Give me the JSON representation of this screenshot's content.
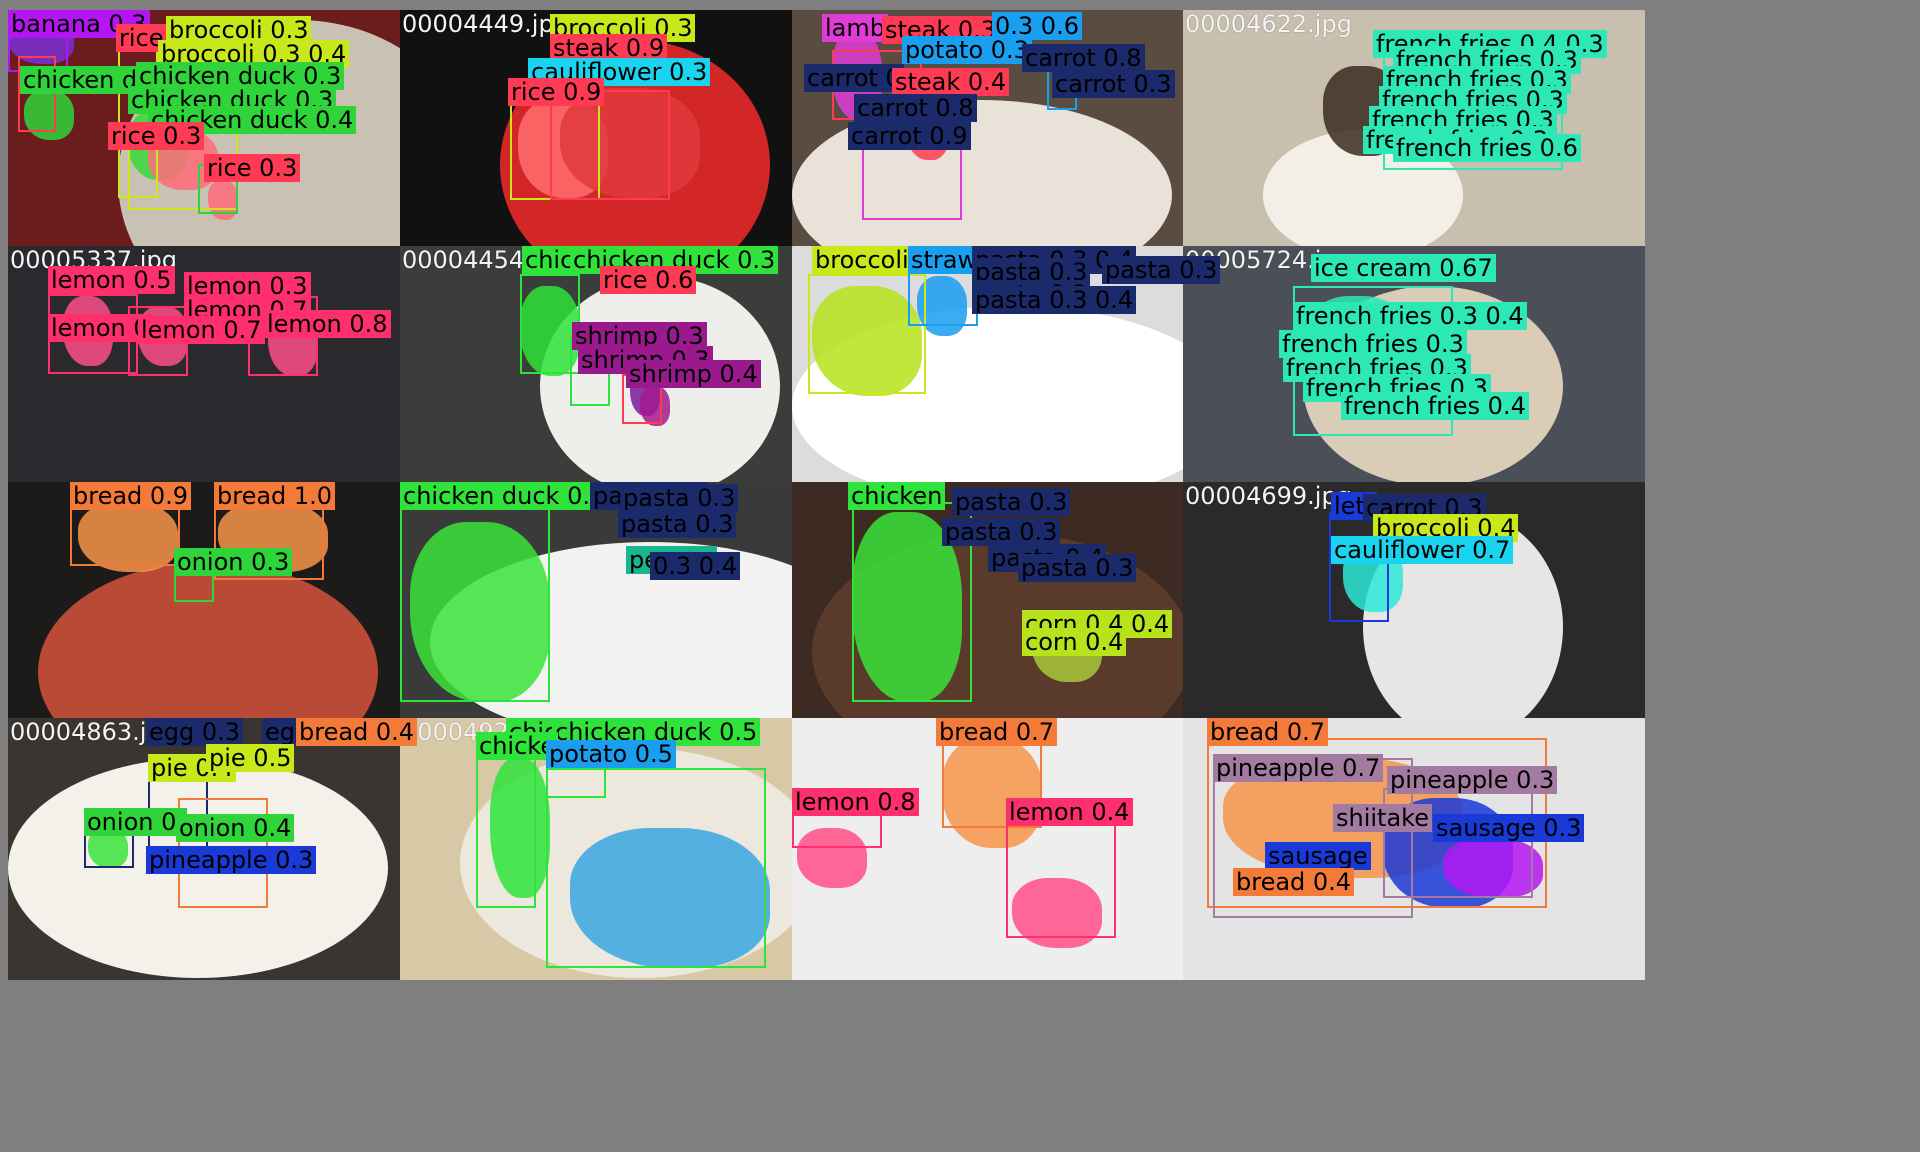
{
  "tiles": [
    {
      "filename": "",
      "bg": "#6b1d1d",
      "plate": {
        "color": "#c9c1b3"
      },
      "masks": [
        {
          "color": "#7a2fd6"
        },
        {
          "color": "#2fd43a"
        },
        {
          "color": "#39d839"
        },
        {
          "color": "#ff6b79"
        },
        {
          "color": "#ff6b79"
        }
      ],
      "labels": [
        {
          "text": "banana 0.3",
          "color": "#b416f2"
        },
        {
          "text": "rice",
          "color": "#ff3a55"
        },
        {
          "text": "broccoli 0.3",
          "color": "#c9e81a"
        },
        {
          "text": "broccoli 0.3 0.4",
          "color": "#c9e81a"
        },
        {
          "text": "chicken duck 0.3",
          "color": "#2fd43a"
        },
        {
          "text": "chicken duck 0.3",
          "color": "#2fd43a"
        },
        {
          "text": "chicken duck 0.3",
          "color": "#2fd43a"
        },
        {
          "text": "chicken duck 0.4",
          "color": "#2fd43a"
        },
        {
          "text": "rice 0.3",
          "color": "#ff3a55"
        },
        {
          "text": "rice 0.3",
          "color": "#ff3a55"
        }
      ]
    },
    {
      "filename": "00004449.jpg",
      "bg": "#111111",
      "plate": {
        "color": "#d32626"
      },
      "masks": [
        {
          "color": "#ff6f6f"
        },
        {
          "color": "#e0393d"
        }
      ],
      "labels": [
        {
          "text": "broccoli 0.3",
          "color": "#c9e81a"
        },
        {
          "text": "steak 0.9",
          "color": "#ff3a55"
        },
        {
          "text": "cauliflower 0.3",
          "color": "#1ad4ef"
        },
        {
          "text": "rice 0.9",
          "color": "#ff3a55"
        }
      ]
    },
    {
      "filename": "",
      "bg": "#5a4c40",
      "plate": {
        "color": "#e8e2d8"
      },
      "masks": [
        {
          "color": "#e13cd7"
        },
        {
          "color": "#ff3a55"
        }
      ],
      "labels": [
        {
          "text": "lamb",
          "color": "#e13cd7"
        },
        {
          "text": "steak 0.3",
          "color": "#ff3a55"
        },
        {
          "text": "0.3 0.6",
          "color": "#1a9ef0"
        },
        {
          "text": "potato 0.3",
          "color": "#1a9ef0"
        },
        {
          "text": "carrot 0.8",
          "color": "#1b2a6a"
        },
        {
          "text": "carrot 0",
          "color": "#1b2a6a"
        },
        {
          "text": "steak 0.4",
          "color": "#ff3a55"
        },
        {
          "text": "carrot 0.3",
          "color": "#1b2a6a"
        },
        {
          "text": "carrot 0.8",
          "color": "#1b2a6a"
        },
        {
          "text": "carrot 0.9",
          "color": "#1b2a6a"
        }
      ]
    },
    {
      "filename": "00004622.jpg",
      "bg": "#c9bfae",
      "plate": {
        "color": "#f3efe6"
      },
      "masks": [
        {
          "color": "#3a2a1e"
        }
      ],
      "labels": [
        {
          "text": "french fries 0.4 0.3",
          "color": "#2ce8b7"
        },
        {
          "text": "french fries 0.3",
          "color": "#2ce8b7"
        },
        {
          "text": "french fries 0.3",
          "color": "#2ce8b7"
        },
        {
          "text": "french fries 0.3",
          "color": "#2ce8b7"
        },
        {
          "text": "french fries 0.3",
          "color": "#2ce8b7"
        },
        {
          "text": "french fries 0.3",
          "color": "#2ce8b7"
        },
        {
          "text": "french fries 0.6",
          "color": "#2ce8b7"
        }
      ]
    },
    {
      "filename": "00005337.jpg",
      "bg": "#2a2a2e",
      "plate": {
        "color": "#c96e62"
      },
      "masks": [
        {
          "color": "#ff4d87"
        },
        {
          "color": "#ff4d87"
        },
        {
          "color": "#ff4d87"
        }
      ],
      "labels": [
        {
          "text": "lemon 0.5",
          "color": "#ff2f6d"
        },
        {
          "text": "lemon 0.3",
          "color": "#ff2f6d"
        },
        {
          "text": "lemon 0.7",
          "color": "#ff2f6d"
        },
        {
          "text": "lemon 0",
          "color": "#ff2f6d"
        },
        {
          "text": "lemon 0.7",
          "color": "#ff2f6d"
        },
        {
          "text": "lemon 0.8",
          "color": "#ff2f6d"
        }
      ]
    },
    {
      "filename": "00004454.jpg",
      "bg": "#3a3d3a",
      "plate": {
        "color": "#eeeeea"
      },
      "masks": [
        {
          "color": "#2fe33a"
        },
        {
          "color": "#7a1a9a"
        },
        {
          "color": "#a21a8e"
        }
      ],
      "labels": [
        {
          "text": "chicken",
          "color": "#2fe33a"
        },
        {
          "text": "chicken duck 0.3",
          "color": "#2fe33a"
        },
        {
          "text": "rice 0.6",
          "color": "#ff3a55"
        },
        {
          "text": "shrimp 0.3",
          "color": "#9a1a8e"
        },
        {
          "text": "shrimp 0.3",
          "color": "#9a1a8e"
        },
        {
          "text": "shrimp 0.4",
          "color": "#9a1a8e"
        }
      ]
    },
    {
      "filename": "",
      "bg": "#dcdcdc",
      "plate": {
        "color": "#ffffff"
      },
      "masks": [
        {
          "color": "#b7e31a"
        },
        {
          "color": "#1a9ef0"
        }
      ],
      "labels": [
        {
          "text": "broccoli 0",
          "color": "#c9e81a"
        },
        {
          "text": "strawb",
          "color": "#1a9ef0"
        },
        {
          "text": "pasta 0.3 0.4",
          "color": "#1b2a6a"
        },
        {
          "text": "pasta 0.3",
          "color": "#1b2a6a"
        },
        {
          "text": "pasta 0.3",
          "color": "#1b2a6a"
        },
        {
          "text": "pasta 0.3",
          "color": "#1b2a6a"
        },
        {
          "text": "pasta 0.3 0.4",
          "color": "#1b2a6a"
        }
      ]
    },
    {
      "filename": "00005724.jpg",
      "bg": "#4b4f57",
      "plate": {
        "color": "#d9cdb8"
      },
      "masks": [
        {
          "color": "#2ce8b7"
        }
      ],
      "labels": [
        {
          "text": "ice cream 0.67",
          "color": "#2ce8b7"
        },
        {
          "text": "french fries 0.3 0.4",
          "color": "#2ce8b7"
        },
        {
          "text": "french fries 0.3",
          "color": "#2ce8b7"
        },
        {
          "text": "french fries 0.3",
          "color": "#2ce8b7"
        },
        {
          "text": "french fries 0.3",
          "color": "#2ce8b7"
        },
        {
          "text": "french fries 0.4",
          "color": "#2ce8b7"
        }
      ]
    },
    {
      "filename": "",
      "bg": "#1d1b1a",
      "plate": {
        "color": "#b94a36"
      },
      "masks": [
        {
          "color": "#f7944a"
        },
        {
          "color": "#f7944a"
        }
      ],
      "labels": [
        {
          "text": "bread 0.9",
          "color": "#f47a3a"
        },
        {
          "text": "bread 1.0",
          "color": "#f47a3a"
        },
        {
          "text": "onion 0.3",
          "color": "#2fd43a"
        }
      ]
    },
    {
      "filename": "",
      "bg": "#3a3a3a",
      "plate": {
        "color": "#f2f2f2"
      },
      "masks": [
        {
          "color": "#39e33a"
        }
      ],
      "labels": [
        {
          "text": "chicken duck 0.9",
          "color": "#2fe33a"
        },
        {
          "text": "pasta 0.3",
          "color": "#1b2a6a"
        },
        {
          "text": "pasta 0.3",
          "color": "#1b2a6a"
        },
        {
          "text": "pasta 0.3",
          "color": "#1b2a6a"
        },
        {
          "text": "pepper",
          "color": "#1ab48e"
        },
        {
          "text": "0.3 0.4",
          "color": "#1b2a6a"
        }
      ]
    },
    {
      "filename": "",
      "bg": "#3d2a22",
      "plate": {
        "color": "#5a3a2a"
      },
      "masks": [
        {
          "color": "#39e33a"
        },
        {
          "color": "#a8c93a"
        }
      ],
      "labels": [
        {
          "text": "chicken",
          "color": "#2fe33a"
        },
        {
          "text": "pasta 0.3",
          "color": "#1b2a6a"
        },
        {
          "text": "pasta 0.3",
          "color": "#1b2a6a"
        },
        {
          "text": "pasta 0.4",
          "color": "#1b2a6a"
        },
        {
          "text": "pasta 0.3",
          "color": "#1b2a6a"
        },
        {
          "text": "corn 0.4 0.4",
          "color": "#b7e31a"
        },
        {
          "text": "corn 0.4",
          "color": "#b7e31a"
        }
      ]
    },
    {
      "filename": "00004699.jpg",
      "bg": "#2a2a2a",
      "plate": {
        "color": "#e6e6e6"
      },
      "masks": [
        {
          "color": "#2ce8d8"
        }
      ],
      "labels": [
        {
          "text": "lett",
          "color": "#1a3ad8"
        },
        {
          "text": "carrot 0.3",
          "color": "#1b2a6a"
        },
        {
          "text": "broccoli 0.4",
          "color": "#c9e81a"
        },
        {
          "text": "cauliflower 0.7",
          "color": "#1ad4ef"
        }
      ]
    },
    {
      "filename": "00004863.jpg",
      "bg": "#3a3530",
      "plate": {
        "color": "#f4f1ea"
      },
      "masks": [
        {
          "color": "#39e33a"
        }
      ],
      "labels": [
        {
          "text": "egg 0.3",
          "color": "#1b2a6a"
        },
        {
          "text": "egg 0.3",
          "color": "#1b2a6a"
        },
        {
          "text": "bread 0.4",
          "color": "#f47a3a"
        },
        {
          "text": "pie 0.4",
          "color": "#c9e81a"
        },
        {
          "text": "pie 0.5",
          "color": "#c9e81a"
        },
        {
          "text": "onion 0.",
          "color": "#2fd43a"
        },
        {
          "text": "onion 0.4",
          "color": "#2fd43a"
        },
        {
          "text": "pineapple 0.3",
          "color": "#1a3ad8"
        }
      ]
    },
    {
      "filename": "00004922.jpg",
      "bg": "#d8c9a6",
      "plate": {
        "color": "#ece8de"
      },
      "masks": [
        {
          "color": "#2fe33a"
        },
        {
          "color": "#3aa6e0"
        }
      ],
      "labels": [
        {
          "text": "chic",
          "color": "#2fe33a"
        },
        {
          "text": "chicken duck 0.5",
          "color": "#2fe33a"
        },
        {
          "text": "chicke",
          "color": "#2fe33a"
        },
        {
          "text": "potato 0.5",
          "color": "#1a9ef0"
        }
      ]
    },
    {
      "filename": "",
      "bg": "#eeeeee",
      "plate": {
        "color": "#ffffff"
      },
      "masks": [
        {
          "color": "#f7944a"
        },
        {
          "color": "#ff4d87"
        },
        {
          "color": "#ff4d87"
        }
      ],
      "labels": [
        {
          "text": "bread 0.7",
          "color": "#f47a3a"
        },
        {
          "text": "lemon 0.8",
          "color": "#ff2f6d"
        },
        {
          "text": "lemon 0.4",
          "color": "#ff2f6d"
        }
      ]
    },
    {
      "filename": "",
      "bg": "#e4e4e4",
      "plate": {
        "color": "#dcdad4"
      },
      "masks": [
        {
          "color": "#f7944a"
        },
        {
          "color": "#1a3ad8"
        },
        {
          "color": "#b416f2"
        }
      ],
      "labels": [
        {
          "text": "bread 0.7",
          "color": "#f47a3a"
        },
        {
          "text": "pineapple 0.7",
          "color": "#a37aa0"
        },
        {
          "text": "pineapple 0.3",
          "color": "#a37aa0"
        },
        {
          "text": "shiitake",
          "color": "#a37aa0"
        },
        {
          "text": "sausage 0.3",
          "color": "#1a3ad8"
        },
        {
          "text": "sausage",
          "color": "#1a3ad8"
        },
        {
          "text": "bread 0.4",
          "color": "#f47a3a"
        }
      ]
    }
  ]
}
